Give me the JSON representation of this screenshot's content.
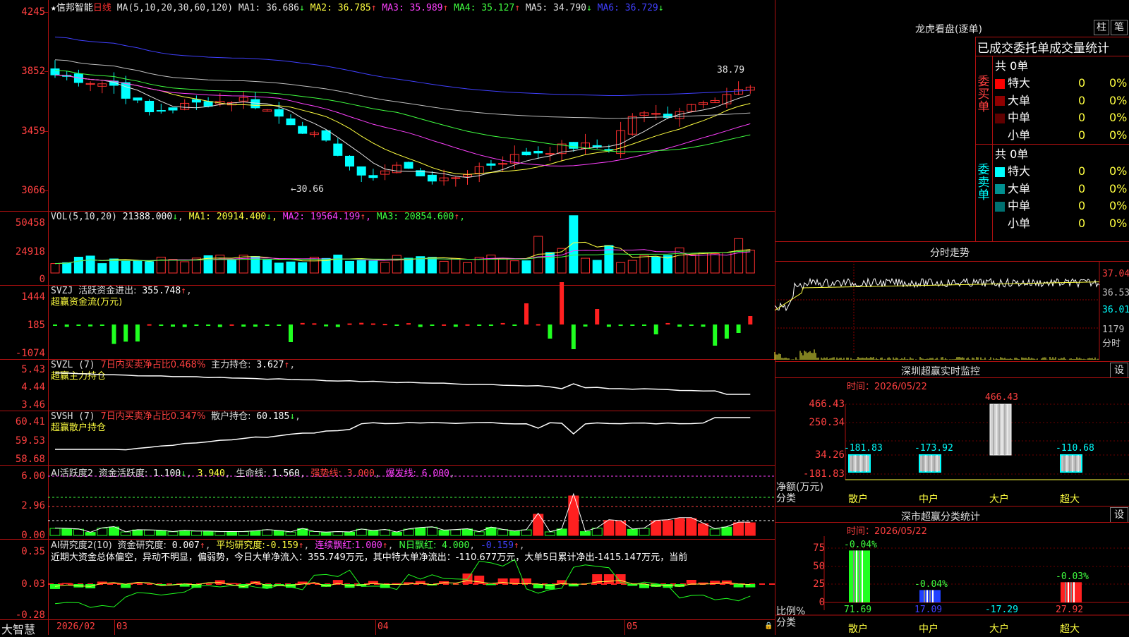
{
  "stock": {
    "star": "★",
    "name": "信邦智能",
    "period": "日线",
    "ma_label": "MA(5,10,20,30,60,120)",
    "ma": [
      {
        "n": "MA1:",
        "v": "36.686",
        "a": "↓",
        "c": "#e0e0e0"
      },
      {
        "n": "MA2:",
        "v": "36.785",
        "a": "↑",
        "c": "#ffff40"
      },
      {
        "n": "MA3:",
        "v": "35.989",
        "a": "↑",
        "c": "#ff40ff"
      },
      {
        "n": "MA4:",
        "v": "35.127",
        "a": "↑",
        "c": "#40ff40"
      },
      {
        "n": "MA5:",
        "v": "34.790",
        "a": "↓",
        "c": "#e0e0e0"
      },
      {
        "n": "MA6:",
        "v": "36.729",
        "a": "↓",
        "c": "#4040ff"
      }
    ]
  },
  "price_axis": [
    "4245",
    "3852",
    "3459",
    "3066"
  ],
  "price_marks": {
    "high": "38.79",
    "low": "30.66"
  },
  "vol": {
    "label": "VOL(5,10,20)",
    "value": "21388.000",
    "a": "↓",
    "ma": [
      {
        "n": "MA1:",
        "v": "20914.400",
        "a": "↓",
        "c": "#ffff40"
      },
      {
        "n": "MA2:",
        "v": "19564.199",
        "a": "↑",
        "c": "#ff40ff"
      },
      {
        "n": "MA3:",
        "v": "20854.600",
        "a": "↑",
        "c": "#40ff40"
      }
    ],
    "axis": [
      "50458",
      "24918",
      "0"
    ]
  },
  "svzj": {
    "label": "SVZJ",
    "t1": "活跃资金进出:",
    "v": "355.748",
    "a": "↑",
    "sub": "超赢资金流(万元)",
    "axis": [
      "1444",
      "185",
      "-1074"
    ]
  },
  "svzl": {
    "label": "SVZL (7)",
    "t1": "7日内买卖净占比0.468%",
    "t2": "主力持仓:",
    "v": "3.627",
    "a": "↑",
    "sub": "超赢主力持仓",
    "axis": [
      "5.43",
      "4.44",
      "3.46"
    ]
  },
  "svsh": {
    "label": "SVSH (7)",
    "t1": "7日内买卖净占比0.347%",
    "t2": "散户持仓:",
    "v": "60.185",
    "a": "↓",
    "sub": "超赢散户持仓",
    "axis": [
      "60.41",
      "59.53",
      "58.68"
    ]
  },
  "ai1": {
    "label": "AI活跃度2",
    "t1": "资金活跃度:",
    "v1": "1.100",
    "a1": "↓",
    "v2": "3.940",
    "t3": "生命线:",
    "v3": "1.560",
    "t4": "强势线:",
    "v4": "3.000",
    "t5": "爆发线:",
    "v5": "6.000",
    "axis": [
      "6.00",
      "2.96",
      "0.00"
    ]
  },
  "ai2": {
    "label": "AI研究度2(10)",
    "t1": "资金研究度:",
    "v1": "0.007",
    "a1": "↑",
    "t2": "平均研究度:",
    "v2": "-0.159",
    "a2": "↑",
    "t3": "连续飘红:",
    "v3": "1.000",
    "a3": "↑",
    "t4": "N日飘红:",
    "v4": "4.000",
    "v5": "-0.159",
    "a5": "↑",
    "text": "近期大资金总体偏空，异动不明显，偏弱势，今日大单净流入：355.749万元，其中特大单净流出：-110.677万元，大单5日累计净出-1415.147万元，当前",
    "axis": [
      "0.35",
      "0.03",
      "-0.28"
    ]
  },
  "dates": {
    "brand": "大智慧",
    "d0": "2026/02",
    "d1": "03",
    "d2": "04",
    "d3": "05"
  },
  "lhb": {
    "title": "龙虎看盘(逐单)",
    "btn1": "柱",
    "btn2": "笔",
    "head": "已成交委托单成交量统计",
    "buy": {
      "side": "委买单",
      "total": "共 0单",
      "rows": [
        {
          "n": "特大",
          "v": "0",
          "p": "0%",
          "c": "#ff0000"
        },
        {
          "n": "大单",
          "v": "0",
          "p": "0%",
          "c": "#900000"
        },
        {
          "n": "中单",
          "v": "0",
          "p": "0%",
          "c": "#600000"
        },
        {
          "n": "小单",
          "v": "0",
          "p": "0%",
          "c": "#000"
        }
      ]
    },
    "sell": {
      "side": "委卖单",
      "total": "共 0单",
      "rows": [
        {
          "n": "特大",
          "v": "0",
          "p": "0%",
          "c": "#00ffff"
        },
        {
          "n": "大单",
          "v": "0",
          "p": "0%",
          "c": "#009090"
        },
        {
          "n": "中单",
          "v": "0",
          "p": "0%",
          "c": "#007070"
        },
        {
          "n": "小单",
          "v": "0",
          "p": "0%",
          "c": "#000"
        }
      ]
    }
  },
  "fenshi": {
    "title": "分时走势",
    "axis": [
      "37.04",
      "36.53",
      "36.01"
    ],
    "vol": "1179",
    "vol2": "分时"
  },
  "sz1": {
    "title": "深圳超赢实时监控",
    "btn": "设",
    "time": "时间：2026/05/22",
    "axis": [
      "466.43",
      "250.34",
      "34.26",
      "-181.83"
    ],
    "ylab": "净额(万元)",
    "xlab": "分类",
    "bars": [
      {
        "cat": "散户",
        "v": "-181.83"
      },
      {
        "cat": "中户",
        "v": "-173.92"
      },
      {
        "cat": "大户",
        "v": "466.43"
      },
      {
        "cat": "超大",
        "v": "-110.68"
      }
    ]
  },
  "sz2": {
    "title": "深市超赢分类统计",
    "btn": "设",
    "time": "时间：2026/05/22",
    "axis": [
      "75",
      "50",
      "25",
      "0"
    ],
    "ylab": "比例%",
    "xlab": "分类",
    "bars": [
      {
        "cat": "散户",
        "top": "-0.04%",
        "v": "71.69"
      },
      {
        "cat": "中户",
        "top": "-0.04%",
        "v": "17.09"
      },
      {
        "cat": "大户",
        "top": "",
        "v": "-17.29"
      },
      {
        "cat": "超大",
        "top": "-0.03%",
        "v": "27.92"
      }
    ]
  }
}
